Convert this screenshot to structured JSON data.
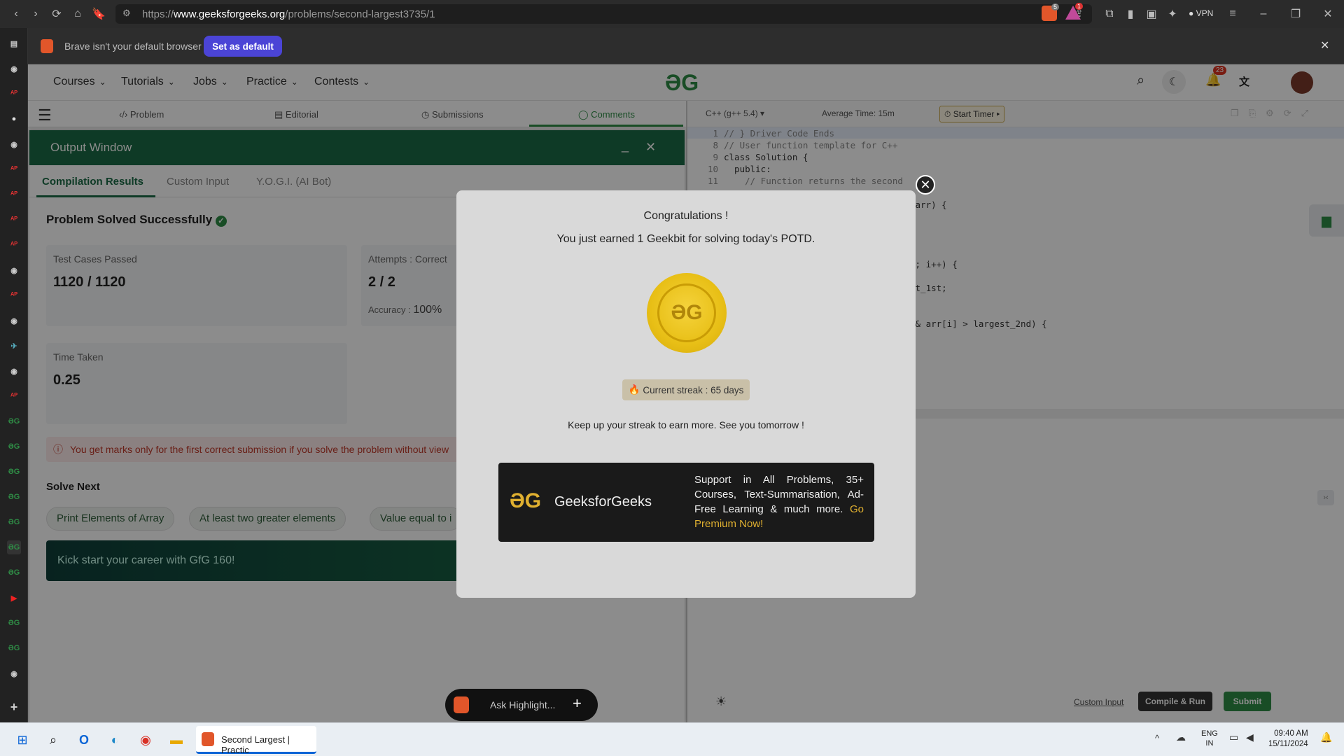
{
  "browser": {
    "url_prefix": "https://",
    "url_domain": "www.geeksforgeeks.org",
    "url_path": "/problems/second-largest3735/1",
    "vpn_label": "VPN",
    "brave_badge": "5",
    "alert_badge": "1"
  },
  "notice": {
    "text": "Brave isn't your default browser",
    "button": "Set as default",
    "close": "✕"
  },
  "nav": {
    "items": [
      "Courses",
      "Tutorials",
      "Jobs",
      "Practice",
      "Contests"
    ],
    "notif_count": "23",
    "logo": "ƏG"
  },
  "problem_tabs": [
    "Problem",
    "Editorial",
    "Submissions",
    "Comments"
  ],
  "editor": {
    "language": "C++ (g++ 5.4)",
    "avg_time": "Average Time: 15m",
    "timer": "Start Timer",
    "lines": [
      {
        "n": "1",
        "code": "// } Driver Code Ends"
      },
      {
        "n": "8",
        "code": "// User function template for C++"
      },
      {
        "n": "9",
        "code": "class Solution {"
      },
      {
        "n": "10",
        "code": "  public:"
      },
      {
        "n": "11",
        "code": "    // Function returns the second"
      }
    ],
    "fragments": [
      "&arr) {",
      "); i++) {",
      "{",
      "st_1st;",
      ";",
      "&& arr[i] > largest_2nd) {",
      ";"
    ],
    "custom_input": "Custom Input",
    "compile_run": "Compile & Run",
    "submit": "Submit"
  },
  "output": {
    "title": "Output Window",
    "tabs": [
      "Compilation Results",
      "Custom Input",
      "Y.O.G.I. (AI Bot)"
    ],
    "status": "Problem Solved Successfully",
    "cards": {
      "tests_label": "Test Cases Passed",
      "tests_value": "1120 / 1120",
      "attempts_label": "Attempts : Correct",
      "attempts_value": "2 / 2",
      "accuracy_label": "Accuracy :",
      "accuracy_value": "100%",
      "time_label": "Time Taken",
      "time_value": "0.25"
    },
    "warning": "You get marks only for the first correct submission if you solve the problem without view",
    "solve_next": "Solve Next",
    "next_problems": [
      "Print Elements of Array",
      "At least two greater elements",
      "Value equal to i"
    ],
    "career": "Kick start your career with GfG 160!"
  },
  "modal": {
    "title": "Congratulations !",
    "earned": "You just earned 1 Geekbit for solving today's POTD.",
    "streak": "Current streak : 65 days",
    "keep_up": "Keep up your streak to earn more. See you tomorrow !",
    "brand": "GeeksforGeeks",
    "promo": "Support in All Problems, 35+ Courses, Text-Summarisation, Ad-Free Learning & much more.",
    "promo_link": "Go Premium Now!"
  },
  "ask": {
    "placeholder": "Ask Highlight..."
  },
  "taskbar": {
    "active_window": "Second Largest | Practic",
    "lang_line1": "ENG",
    "lang_line2": "IN",
    "time": "09:40 AM",
    "date": "15/11/2024"
  },
  "colors": {
    "gfg_green": "#2f8d46",
    "accent_purple": "#4b44d6",
    "gold": "#e8bf16"
  }
}
